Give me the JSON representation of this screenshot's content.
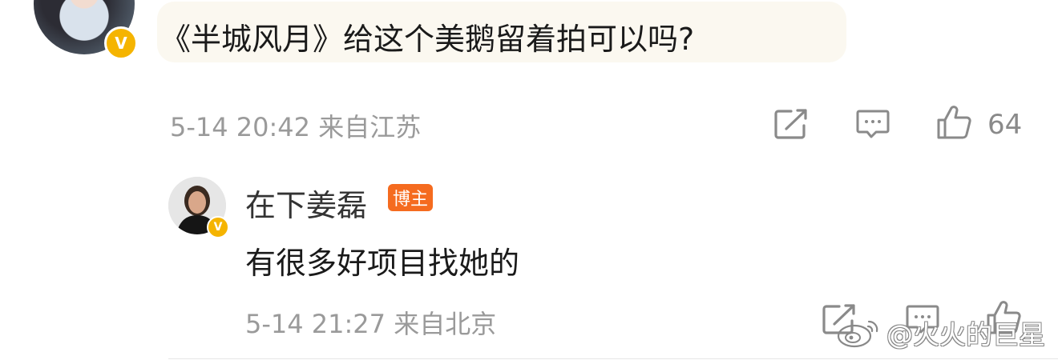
{
  "comment": {
    "text": "《半城风月》给这个美鹅留着拍可以吗?",
    "meta": "5-14 20:42 来自江苏",
    "like_count": "64",
    "avatar_badge": "V"
  },
  "reply": {
    "username": "在下姜磊",
    "author_badge": "博主",
    "text": "有很多好项目找她的",
    "meta": "5-14 21:27 来自北京",
    "avatar_badge": "V"
  },
  "watermark": {
    "text": "@火火的巨星"
  },
  "colors": {
    "verified": "#f5b400",
    "author_badge": "#f56b1f",
    "meta_text": "#9a9a9a",
    "bubble": "#fbf8f0"
  },
  "icons": {
    "share": "share-icon",
    "comment": "comment-icon",
    "like": "thumbs-up-icon"
  }
}
